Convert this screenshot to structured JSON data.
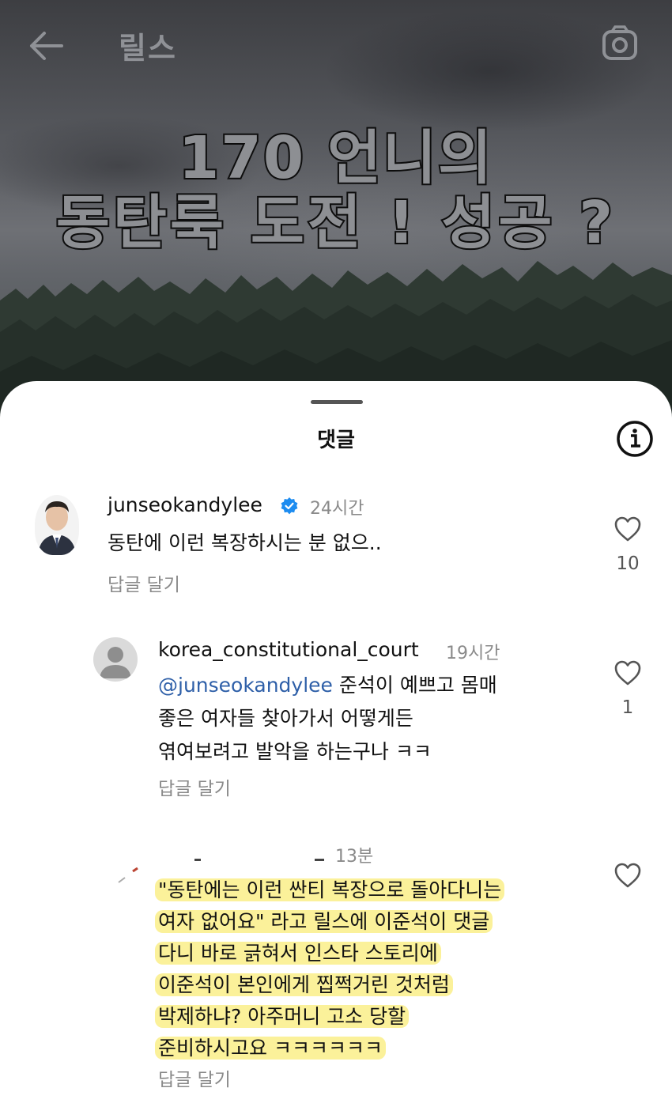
{
  "header": {
    "title": "릴스",
    "caption_line1": "170 언니의",
    "caption_line2": "동탄룩 도전 ! 성공 ?"
  },
  "sheet": {
    "title": "댓글"
  },
  "comments": [
    {
      "username": "junseokandylee",
      "verified": true,
      "time": "24시간",
      "text_lines": [
        "동탄에 이런 복장하시는 분 없으.."
      ],
      "reply_label": "답글 달기",
      "likes": "10"
    },
    {
      "username": "korea_constitutional_court",
      "time": "19시간",
      "mention": "@junseokandylee",
      "text_lines": [
        " 준석이 예쁘고 몸매",
        "좋은 여자들 찾아가서 어떻게든",
        "엮여보려고 발악을 하는구나 ㅋㅋ"
      ],
      "reply_label": "답글 달기",
      "likes": "1"
    },
    {
      "username": "",
      "time": "13분",
      "text_lines": [
        "\"동탄에는 이런 싼티 복장으로 돌아다니는",
        "여자 없어요\" 라고 릴스에 이준석이 댓글",
        "다니 바로 긁혀서 인스타 스토리에",
        "이준석이 본인에게 찝쩍거린 것처럼",
        "박제하냐? 아주머니 고소 당할",
        "준비하시고요 ㅋㅋㅋㅋㅋㅋ"
      ],
      "reply_label": "답글 달기",
      "likes": ""
    }
  ],
  "icons": {
    "back": "back-arrow-icon",
    "camera": "camera-icon",
    "info": "info-icon",
    "heart": "heart-icon",
    "verified": "verified-badge-icon"
  },
  "colors": {
    "mention": "#2e5fa8",
    "highlight": "#faec78",
    "verified": "#1d8cf0"
  }
}
